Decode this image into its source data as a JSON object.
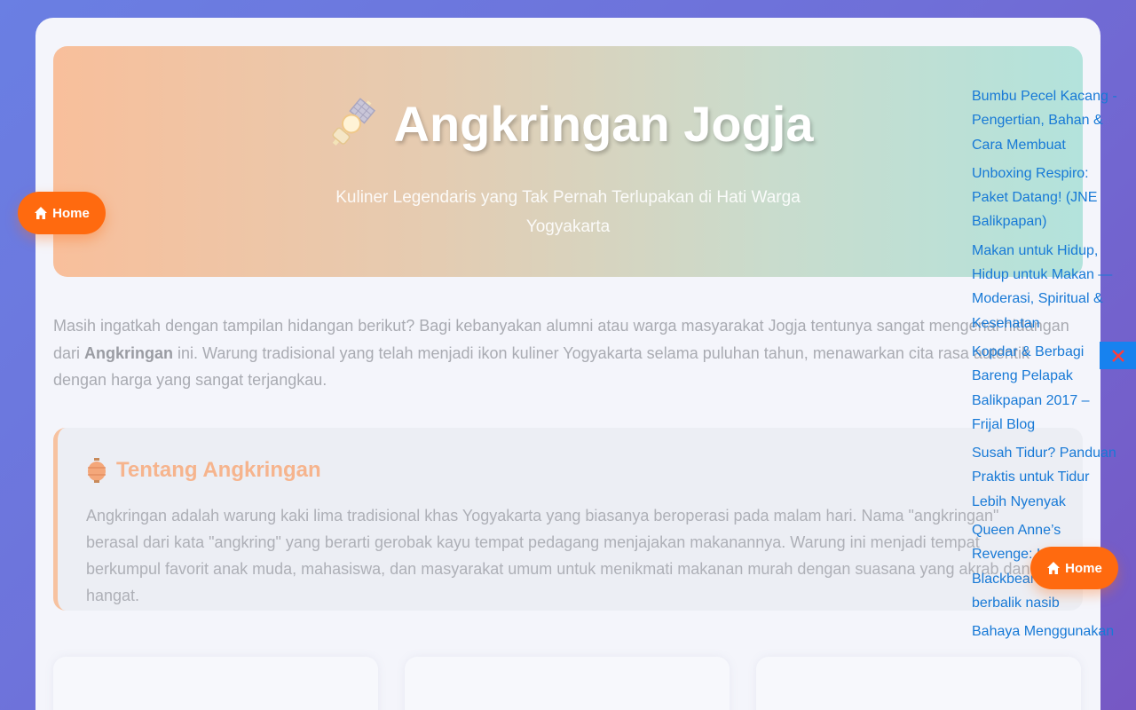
{
  "hero": {
    "title": "Angkringan Jogja",
    "subtitle": "Kuliner Legendaris yang Tak Pernah Terlupakan di Hati Warga Yogyakarta",
    "icon": "skewer-icon"
  },
  "intro": {
    "text_before": "Masih ingatkah dengan tampilan hidangan berikut? Bagi kebanyakan alumni atau warga masyarakat Jogja tentunya sangat mengenal hidangan dari ",
    "bold": "Angkringan",
    "text_after": " ini. Warung tradisional yang telah menjadi ikon kuliner Yogyakarta selama puluhan tahun, menawarkan cita rasa autentik dengan harga yang sangat terjangkau."
  },
  "about": {
    "heading": "Tentang Angkringan",
    "icon": "lantern-icon",
    "body": "Angkringan adalah warung kaki lima tradisional khas Yogyakarta yang biasanya beroperasi pada malam hari. Nama \"angkringan\" berasal dari kata \"angkring\" yang berarti gerobak kayu tempat pedagang menjajakan makanannya. Warung ini menjadi tempat berkumpul favorit anak muda, mahasiswa, dan masyarakat umum untuk menikmati makanan murah dengan suasana yang akrab dan hangat."
  },
  "home_button_label": "Home",
  "side_links": [
    "Bumbu Pecel Kacang - Pengertian, Bahan & Cara Membuat",
    "Unboxing Respiro: Paket Datang! (JNE Balikpapan)",
    "Makan untuk Hidup, Hidup untuk Makan — Moderasi, Spiritual & Kesehatan",
    "Kopdar & Berbagi Bareng Pelapak Balikpapan 2017 – Frijal Blog",
    "Susah Tidur? Panduan Praktis untuk Tidur Lebih Nyenyak",
    "Queen Anne’s Revenge: Kapal Blackbeard yang berbalik nasib",
    "Bahaya Menggunakan"
  ],
  "colors": {
    "accent": "#ff6a0f",
    "link": "#1779d6",
    "close": "#1782ef"
  }
}
